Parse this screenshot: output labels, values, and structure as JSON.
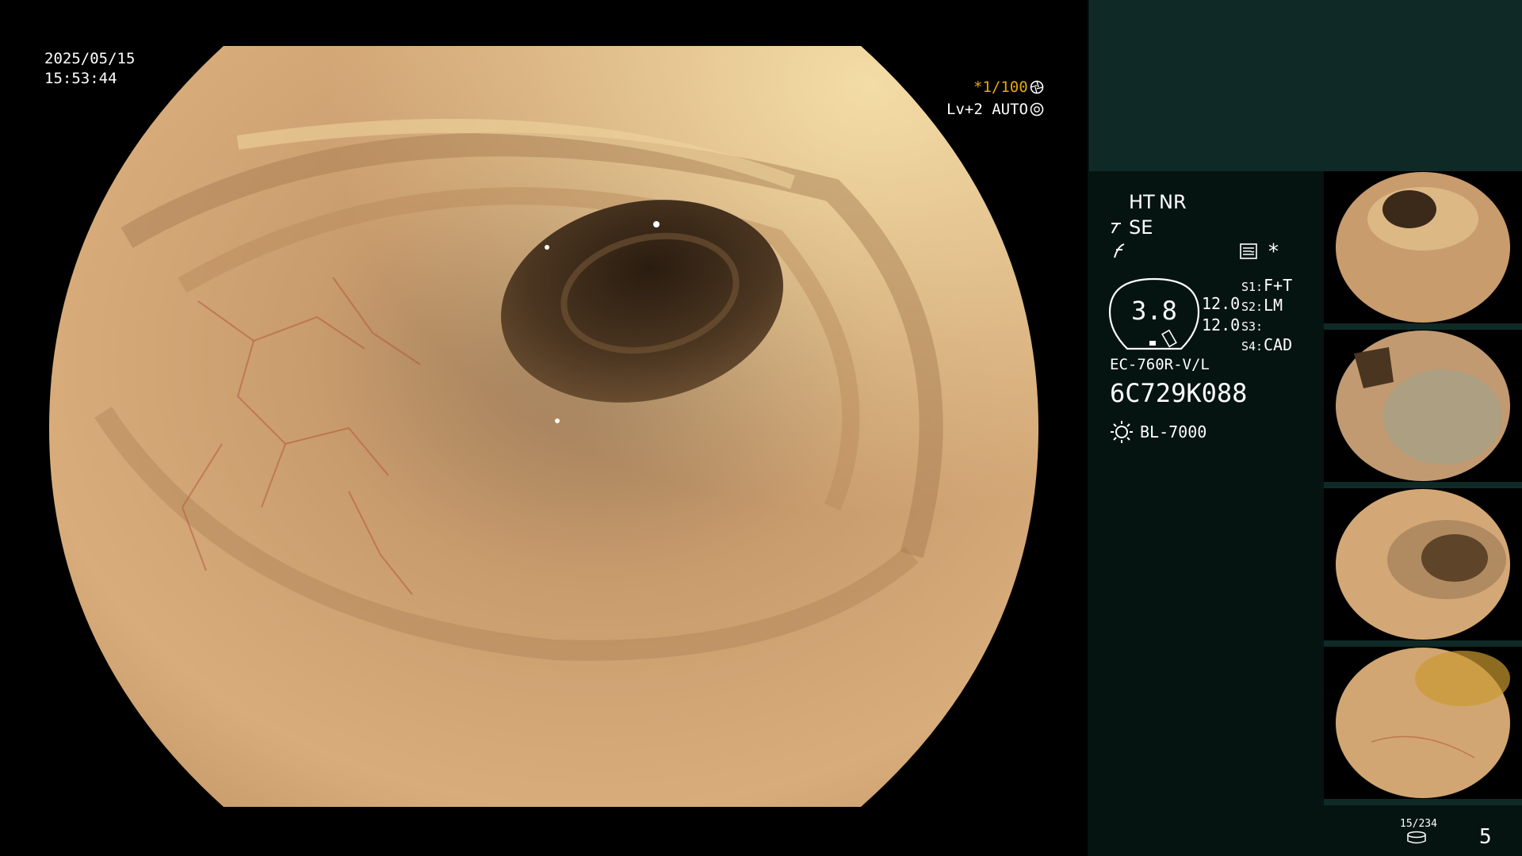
{
  "overlay": {
    "date": "2025/05/15",
    "time": "15:53:44",
    "shutter": "*1/100",
    "level_auto": "Lv+2 AUTO"
  },
  "panel": {
    "ht": "HT",
    "nr": "NR",
    "se": "SE",
    "dial_value": "3.8",
    "val_top": "12.0",
    "val_bottom": "12.0",
    "s1_label": "S1:",
    "s1_value": "F+T",
    "s2_label": "S2:",
    "s2_value": "LM",
    "s3_label": "S3:",
    "s3_value": "",
    "s4_label": "S4:",
    "s4_value": "CAD",
    "model": "EC-760R-V/L",
    "serial": "6C729K088",
    "light_source": "BL-7000",
    "asterisk": "*"
  },
  "footer": {
    "storage": "15/234",
    "count": "5"
  },
  "colors": {
    "amber": "#e8a800",
    "panel_bg": "#061411",
    "panel_header": "#0f2a26"
  },
  "icons": [
    "shutter-icon",
    "auto-iris-icon",
    "scope-curve-icon",
    "freeze-icon",
    "image-mode-icon",
    "light-icon",
    "media-icon"
  ]
}
